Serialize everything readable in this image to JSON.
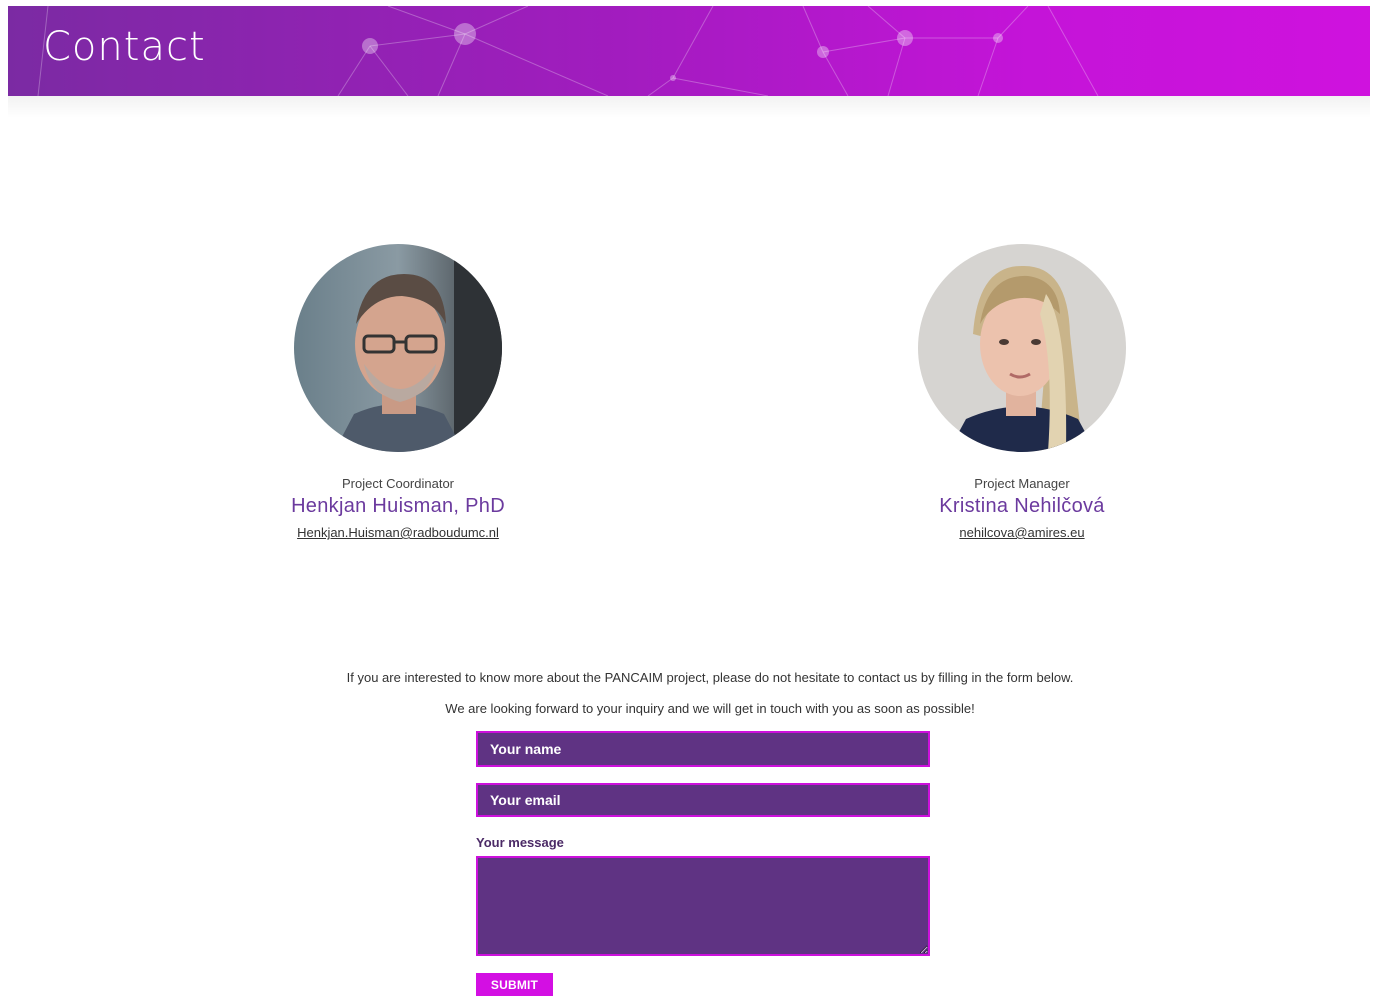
{
  "header": {
    "title": "Contact"
  },
  "team": [
    {
      "role": "Project Coordinator",
      "name": "Henkjan Huisman, PhD",
      "email": "Henkjan.Huisman@radboudumc.nl"
    },
    {
      "role": "Project Manager",
      "name": "Kristina Nehilčová",
      "email": "nehilcova@amires.eu"
    }
  ],
  "intro": {
    "line1": "If you are interested to know more about the PANCAIM project, please do not hesitate to contact us by filling in the form below.",
    "line2": "We are looking forward to your inquiry and we will get in touch with you as soon as possible!"
  },
  "form": {
    "name_placeholder": "Your name",
    "email_placeholder": "Your email",
    "message_label": "Your message",
    "message_value": "",
    "submit_label": "SUBMIT"
  },
  "colors": {
    "banner_start": "#7b2aa3",
    "banner_end": "#cf12de",
    "field_bg": "#5f3383",
    "field_border": "#cc10dc",
    "accent_name": "#6b3a9e",
    "submit_bg": "#d30fe3"
  }
}
